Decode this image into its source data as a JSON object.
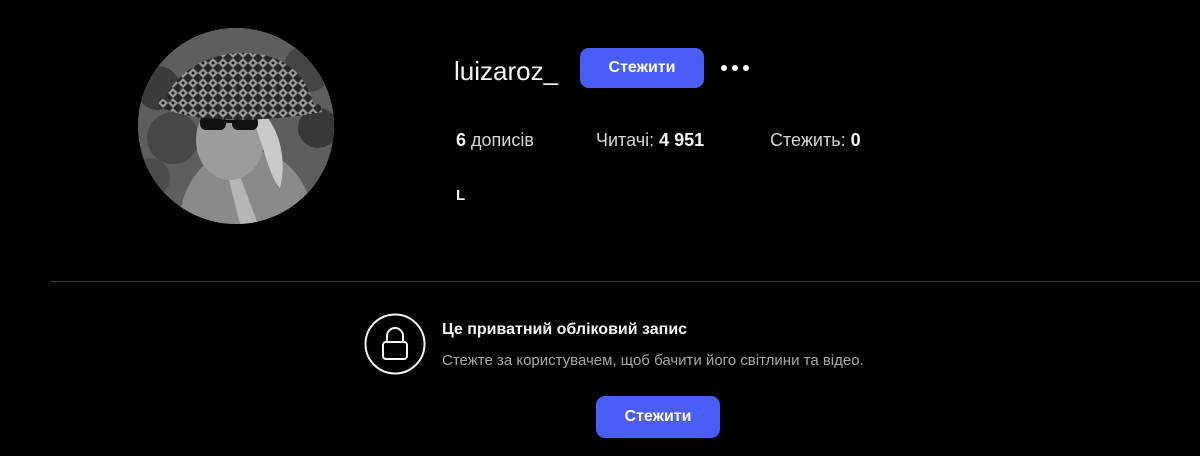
{
  "profile": {
    "username": "luizaroz_",
    "follow_label": "Стежити",
    "more_icon": "more-horizontal-icon",
    "avatar_icon": "profile-photo",
    "bio": "L"
  },
  "stats": {
    "posts_count": "6",
    "posts_label": "дописів",
    "followers_label": "Читачі:",
    "followers_count": "4 951",
    "following_label": "Стежить:",
    "following_count": "0"
  },
  "private_notice": {
    "icon": "lock-icon",
    "title": "Це приватний обліковий запис",
    "description": "Стежте за користувачем, щоб бачити його світлини та відео.",
    "follow_label": "Стежити"
  },
  "colors": {
    "background": "#000000",
    "accent": "#4a5df9",
    "text_primary": "#f5f5f5",
    "text_secondary": "#a8a8a8",
    "divider": "#3a3a3a"
  }
}
